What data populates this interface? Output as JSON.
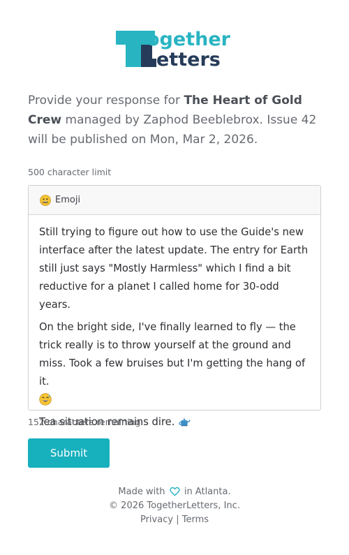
{
  "brand": {
    "logo_top": "ogether",
    "logo_bottom": "etters",
    "teal": "#29b4c2",
    "navy": "#253b59"
  },
  "intro": {
    "prefix": "Provide your response for ",
    "group_name": "The Heart of Gold Crew",
    "suffix": " managed by Zaphod Beeblebrox. Issue 42 will be published on Mon, Mar 2, 2026."
  },
  "form": {
    "char_limit": "500 character limit",
    "emoji_button": "Emoji",
    "paragraphs": [
      "Still trying to figure out how to use the Guide's new interface after the latest update. The entry for Earth still just says \"Mostly Harmless\" which I find a bit reductive for a planet I called home for 30-odd years.",
      "On the bright side, I've finally learned to fly — the trick really is to throw yourself at the ground and miss. Took a few bruises but I'm getting the hang of it.",
      "Tea situation remains dire."
    ],
    "remaining": "152 characters remaining",
    "submit_label": "Submit"
  },
  "footer": {
    "made_with": "Made with",
    "in_city": "in Atlanta.",
    "copyright": "© 2026 TogetherLetters, Inc.",
    "privacy": "Privacy",
    "separator": "|",
    "terms": "Terms"
  },
  "icons": {
    "emoji_button_icon": "grinning-face-icon",
    "sweat_smile_icon": "sweat-smile-icon",
    "teapot_icon": "teapot-icon",
    "heart_icon": "heart-outline-icon"
  },
  "colors": {
    "accent": "#17b0bd"
  }
}
